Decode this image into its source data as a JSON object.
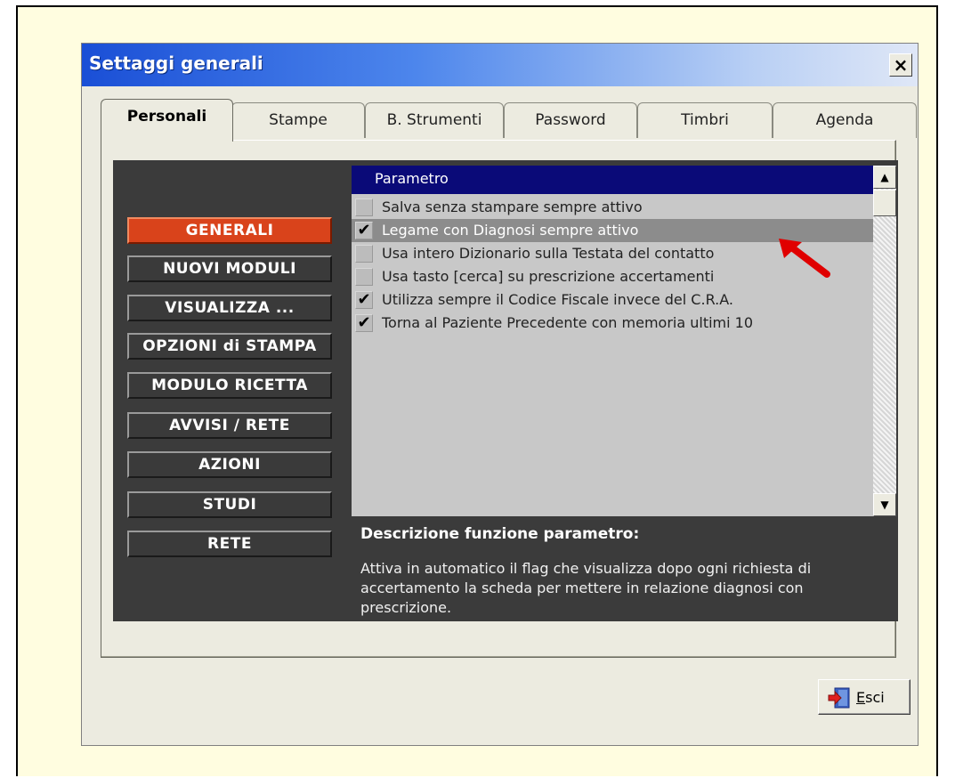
{
  "dialog": {
    "title": "Settaggi generali",
    "close_label": "×"
  },
  "tabs": [
    {
      "label": "Personali",
      "active": true
    },
    {
      "label": "Stampe",
      "active": false
    },
    {
      "label": "B. Strumenti",
      "active": false
    },
    {
      "label": "Password",
      "active": false
    },
    {
      "label": "Timbri",
      "active": false
    },
    {
      "label": "Agenda",
      "active": false
    }
  ],
  "sidebar": {
    "items": [
      {
        "label": "GENERALI",
        "active": true
      },
      {
        "label": "NUOVI MODULI",
        "active": false
      },
      {
        "label": "VISUALIZZA ...",
        "active": false
      },
      {
        "label": "OPZIONI di STAMPA",
        "active": false
      },
      {
        "label": "MODULO RICETTA",
        "active": false
      },
      {
        "label": "AVVISI / RETE",
        "active": false
      },
      {
        "label": "AZIONI",
        "active": false
      },
      {
        "label": "STUDI",
        "active": false
      },
      {
        "label": "RETE",
        "active": false
      }
    ]
  },
  "params": {
    "header": "Parametro",
    "rows": [
      {
        "label": "Salva senza stampare sempre attivo",
        "checked": false,
        "selected": false,
        "mark": ""
      },
      {
        "label": "Legame con Diagnosi sempre attivo",
        "checked": true,
        "selected": true,
        "mark": "✔"
      },
      {
        "label": "Usa intero Dizionario sulla Testata del contatto",
        "checked": false,
        "selected": false,
        "mark": ""
      },
      {
        "label": "Usa tasto [cerca] su prescrizione accertamenti",
        "checked": false,
        "selected": false,
        "mark": ""
      },
      {
        "label": "Utilizza sempre il Codice Fiscale invece del C.R.A.",
        "checked": true,
        "selected": false,
        "mark": "✔"
      },
      {
        "label": "Torna al Paziente Precedente con memoria ultimi 10",
        "checked": true,
        "selected": false,
        "mark": "✔"
      }
    ]
  },
  "scrollbar": {
    "up_glyph": "▲",
    "down_glyph": "▼"
  },
  "description": {
    "title": "Descrizione funzione parametro:",
    "text": "Attiva in automatico il flag che visualizza dopo ogni richiesta di accertamento la scheda per mettere in relazione diagnosi con prescrizione."
  },
  "exit_button": {
    "label": "Esci",
    "icon": "exit-door-icon"
  },
  "annotation": {
    "icon": "red-arrow-icon",
    "color": "#e00000"
  },
  "colors": {
    "title_bar": "#1a4fd6",
    "list_header": "#0a0a78",
    "active_sidebar": "#d9431b",
    "panel_bg": "#3b3b3b",
    "frame_bg": "#fffde0"
  }
}
